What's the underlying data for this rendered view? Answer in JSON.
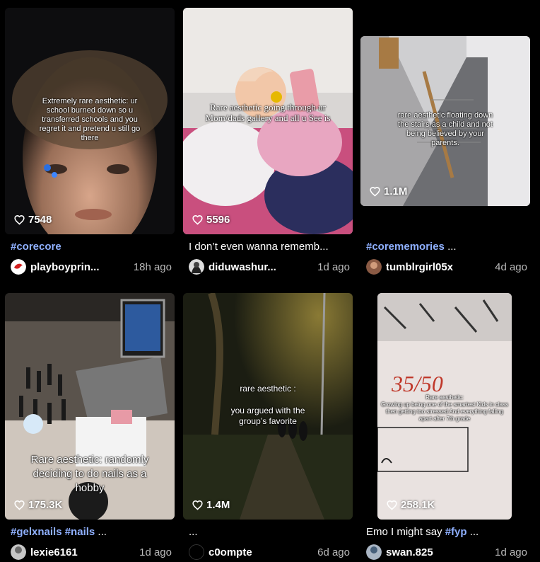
{
  "videos": [
    {
      "overlay": "Extremely rare aesthetic: ur school burned down so u transferred schools and you regret it and pretend u still go there",
      "likes": "7548",
      "caption": "#corecore",
      "caption_is_tag": true,
      "username": "playboyprin...",
      "time": "18h ago"
    },
    {
      "overlay": "Rare aesthetic going through ur Mom/dads gallery and all u See is",
      "likes": "5596",
      "caption": "I don’t even wanna rememb...",
      "caption_is_tag": false,
      "username": "diduwashur...",
      "time": "1d ago"
    },
    {
      "overlay": "rare aesthetic floating down the stairs as a child and not being believed by your parents.",
      "likes": "1.1M",
      "caption_tag": "#corememories",
      "caption_rest": " ...",
      "username": "tumblrgirl05x",
      "time": "4d ago"
    },
    {
      "overlay": "Rare aesthetic: randomly deciding to do nails as a hobby",
      "likes": "175.3K",
      "caption_tag1": "#gelxnails",
      "caption_tag2": "#nails",
      "caption_rest": " ...",
      "username": "lexie6161",
      "time": "1d ago"
    },
    {
      "overlay_line1": "rare aesthetic :",
      "overlay_line2": "you argued with the group’s favorite",
      "likes": "1.4M",
      "caption": "...",
      "username": "c0ompte",
      "time": "6d ago"
    },
    {
      "paper_score": "35/50",
      "overlay_line1": "Rare aesthetic:",
      "overlay_line2": "Growing up being one of the smartest Kids in class then getting too stressed And everything falling apart after 7th grade",
      "likes": "258.1K",
      "caption_text": "Emo I might say ",
      "caption_tag": "#fyp",
      "caption_rest": " ...",
      "username": "swan.825",
      "time": "1d ago"
    }
  ],
  "colors": {
    "background": "#000000",
    "hashtag": "#8fb0ff",
    "timestamp": "#b9b9b9"
  },
  "icons": {
    "likes": "heart-outline-icon"
  }
}
